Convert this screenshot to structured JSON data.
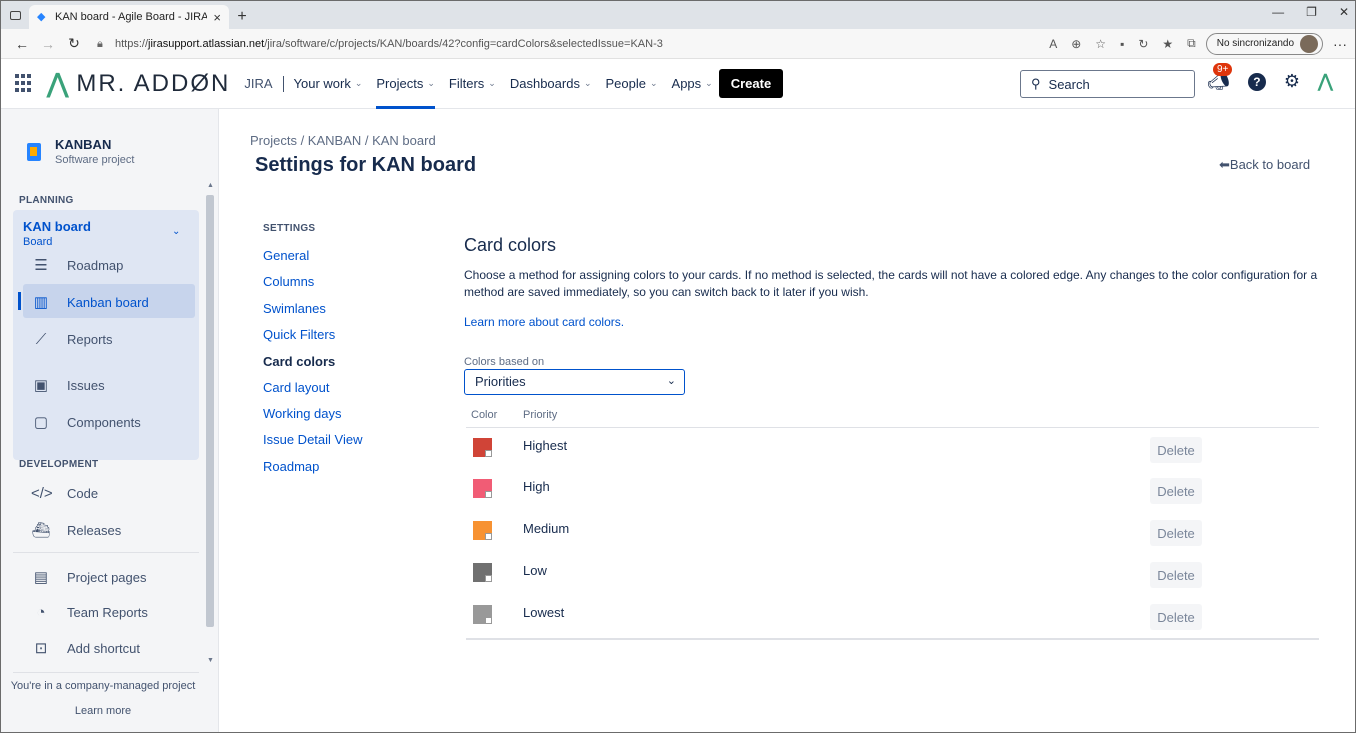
{
  "browser": {
    "tab_title": "KAN board - Agile Board - JIRA",
    "url_prefix": "https://",
    "url_host": "jirasupport.atlassian.net",
    "url_path": "/jira/software/c/projects/KAN/boards/42?config=cardColors&selectedIssue=KAN-3",
    "sync_label": "No sincronizando"
  },
  "nav": {
    "logo_text": "MR. ADDØN",
    "jira_label": "JIRA",
    "menu": [
      {
        "label": "Your work",
        "chevron": true,
        "active": false
      },
      {
        "label": "Projects",
        "chevron": true,
        "active": true
      },
      {
        "label": "Filters",
        "chevron": true,
        "active": false
      },
      {
        "label": "Dashboards",
        "chevron": true,
        "active": false
      },
      {
        "label": "People",
        "chevron": true,
        "active": false
      },
      {
        "label": "Apps",
        "chevron": true,
        "active": false
      }
    ],
    "create_label": "Create",
    "search_placeholder": "Search",
    "notifications_badge": "9+"
  },
  "sidebar": {
    "project_name": "KANBAN",
    "project_type": "Software project",
    "planning_title": "PLANNING",
    "board_name": "KAN board",
    "board_type": "Board",
    "planning_items": [
      {
        "label": "Roadmap",
        "icon": "roadmap-icon"
      },
      {
        "label": "Kanban board",
        "icon": "kanban-icon"
      },
      {
        "label": "Reports",
        "icon": "reports-icon"
      }
    ],
    "other_items": [
      {
        "label": "Issues",
        "icon": "issues-icon"
      },
      {
        "label": "Components",
        "icon": "components-icon"
      }
    ],
    "development_title": "DEVELOPMENT",
    "dev_items": [
      {
        "label": "Code",
        "icon": "code-icon"
      },
      {
        "label": "Releases",
        "icon": "releases-icon"
      }
    ],
    "bottom_items": [
      {
        "label": "Project pages",
        "icon": "project-pages-icon"
      },
      {
        "label": "Team Reports",
        "icon": "team-reports-icon"
      },
      {
        "label": "Add shortcut",
        "icon": "add-shortcut-icon"
      }
    ],
    "company_note": "You're in a company-managed project",
    "learn_more": "Learn more"
  },
  "main": {
    "breadcrumb": "Projects  /  KANBAN  /  KAN board",
    "title": "Settings for KAN board",
    "back_label": "Back to board",
    "settings_title": "SETTINGS",
    "settings_links": [
      "General",
      "Columns",
      "Swimlanes",
      "Quick Filters",
      "Card colors",
      "Card layout",
      "Working days",
      "Issue Detail View",
      "Roadmap"
    ],
    "settings_current": "Card colors",
    "section_title": "Card colors",
    "description": "Choose a method for assigning colors to your cards. If no method is selected, the cards will not have a colored edge. Any changes to the color configuration for a method are saved immediately, so you can switch back to it later if you wish.",
    "learn_link": "Learn more about card colors.",
    "colors_based_on_label": "Colors based on",
    "colors_based_on_value": "Priorities",
    "table_headers": {
      "color": "Color",
      "priority": "Priority"
    },
    "rows": [
      {
        "priority": "Highest",
        "color": "#d04437",
        "delete": "Delete"
      },
      {
        "priority": "High",
        "color": "#f15c75",
        "delete": "Delete"
      },
      {
        "priority": "Medium",
        "color": "#f79232",
        "delete": "Delete"
      },
      {
        "priority": "Low",
        "color": "#707070",
        "delete": "Delete"
      },
      {
        "priority": "Lowest",
        "color": "#999999",
        "delete": "Delete"
      }
    ]
  }
}
